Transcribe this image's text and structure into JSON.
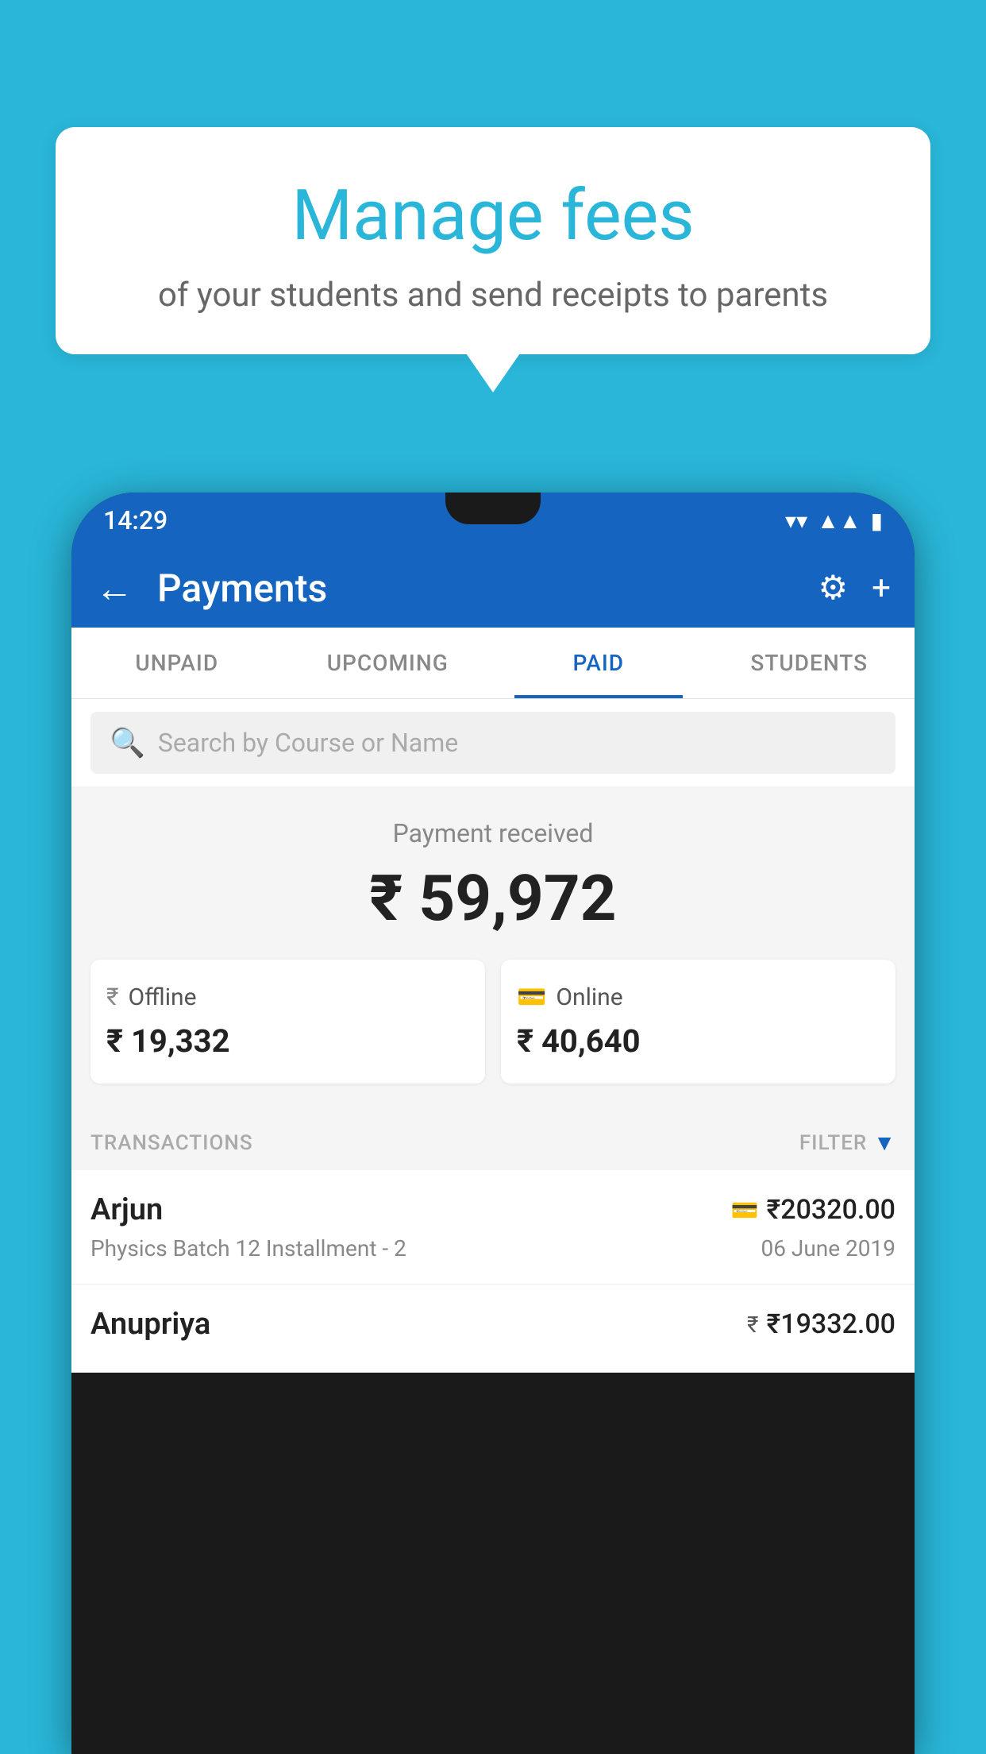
{
  "background_color": "#29b6d8",
  "speech_bubble": {
    "title": "Manage fees",
    "subtitle": "of your students and send receipts to parents"
  },
  "phone": {
    "status_bar": {
      "time": "14:29",
      "icons": [
        "wifi",
        "signal",
        "battery"
      ]
    },
    "header": {
      "title": "Payments",
      "back_label": "←",
      "settings_label": "⚙",
      "add_label": "+"
    },
    "tabs": [
      {
        "label": "UNPAID",
        "active": false
      },
      {
        "label": "UPCOMING",
        "active": false
      },
      {
        "label": "PAID",
        "active": true
      },
      {
        "label": "STUDENTS",
        "active": false
      }
    ],
    "search": {
      "placeholder": "Search by Course or Name"
    },
    "payment_summary": {
      "label": "Payment received",
      "total": "₹ 59,972",
      "offline": {
        "type": "Offline",
        "amount": "₹ 19,332"
      },
      "online": {
        "type": "Online",
        "amount": "₹ 40,640"
      }
    },
    "transactions_section": {
      "label": "TRANSACTIONS",
      "filter_label": "FILTER"
    },
    "transactions": [
      {
        "name": "Arjun",
        "course": "Physics Batch 12 Installment - 2",
        "amount": "₹20320.00",
        "date": "06 June 2019",
        "payment_method": "online"
      },
      {
        "name": "Anupriya",
        "course": "",
        "amount": "₹19332.00",
        "date": "",
        "payment_method": "offline"
      }
    ]
  }
}
